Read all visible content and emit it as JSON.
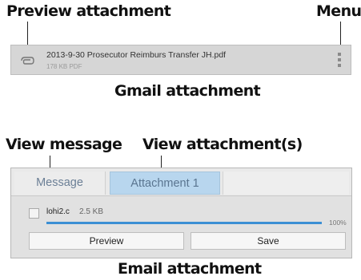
{
  "callouts": {
    "preview_attachment": "Preview attachment",
    "menu": "Menu",
    "gmail_caption": "Gmail attachment",
    "view_message": "View message",
    "view_attachments": "View attachment(s)",
    "email_caption": "Email attachment"
  },
  "gmail": {
    "icon": "paperclip-icon",
    "filename": "2013-9-30  Prosecutor Reimburs Transfer  JH.pdf",
    "meta": "178 KB PDF",
    "menu_icon": "overflow-menu-icon"
  },
  "email": {
    "tabs": {
      "message": "Message",
      "attachment": "Attachment 1"
    },
    "file": {
      "name": "lohi2.c",
      "size": "2.5 KB",
      "progress_percent": 100,
      "progress_label": "100%"
    },
    "buttons": {
      "preview": "Preview",
      "save": "Save"
    }
  },
  "colors": {
    "active_tab": "#b8d6ee",
    "progress": "#3c8fd4"
  }
}
